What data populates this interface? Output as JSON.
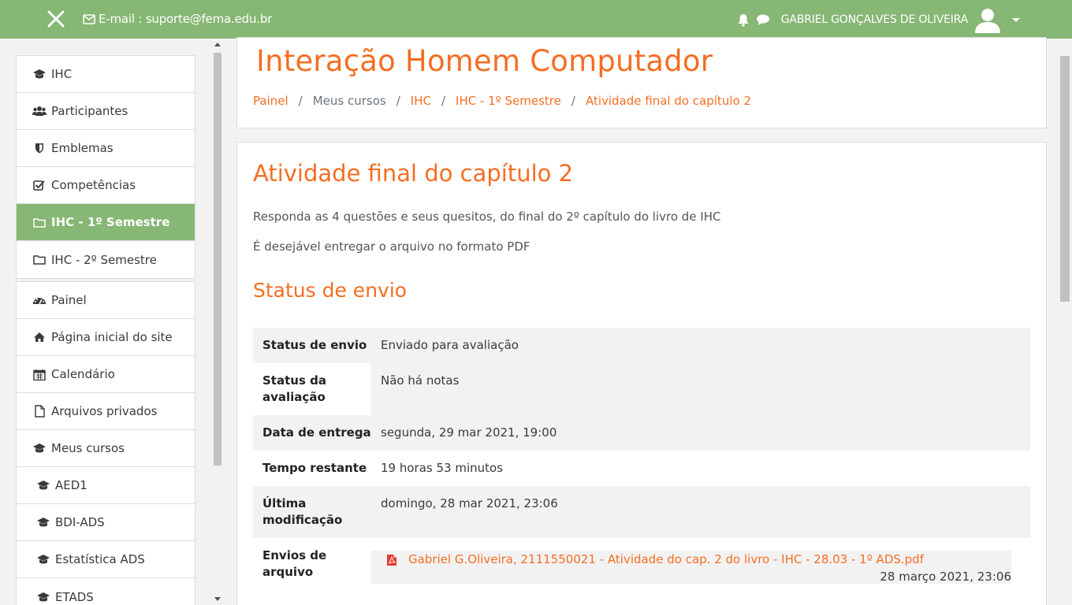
{
  "navbar": {
    "email_label": "E-mail : suporte@fema.edu.br",
    "username": "GABRIEL GONÇALVES DE OLIVEIRA"
  },
  "sidebar": {
    "course_items": [
      {
        "label": "IHC",
        "icon": "graduation-cap-icon"
      },
      {
        "label": "Participantes",
        "icon": "users-icon"
      },
      {
        "label": "Emblemas",
        "icon": "shield-icon"
      },
      {
        "label": "Competências",
        "icon": "checkbox-icon"
      },
      {
        "label": "IHC - 1º Semestre",
        "icon": "folder-icon",
        "active": true
      },
      {
        "label": "IHC - 2º Semestre",
        "icon": "folder-icon"
      }
    ],
    "site_items": [
      {
        "label": "Painel",
        "icon": "dashboard-icon"
      },
      {
        "label": "Página inicial do site",
        "icon": "home-icon"
      },
      {
        "label": "Calendário",
        "icon": "calendar-icon"
      },
      {
        "label": "Arquivos privados",
        "icon": "file-icon"
      },
      {
        "label": "Meus cursos",
        "icon": "graduation-cap-icon"
      },
      {
        "label": "AED1",
        "icon": "graduation-cap-icon"
      },
      {
        "label": "BDI-ADS",
        "icon": "graduation-cap-icon"
      },
      {
        "label": "Estatística ADS",
        "icon": "graduation-cap-icon"
      },
      {
        "label": "ETADS",
        "icon": "graduation-cap-icon"
      }
    ]
  },
  "header": {
    "title": "Interação Homem Computador",
    "breadcrumb": [
      "Painel",
      "Meus cursos",
      "IHC",
      "IHC - 1º Semestre",
      "Atividade final do capítulo 2"
    ]
  },
  "activity": {
    "title": "Atividade final do capítulo 2",
    "desc1": "Responda as 4 questões e seus quesitos, do final do 2º capítulo do livro de IHC",
    "desc2": "É desejável entregar o arquivo no formato PDF",
    "status_heading": "Status de envio",
    "rows": [
      {
        "key": "Status de envio",
        "value": "Enviado para avaliação"
      },
      {
        "key": "Status da avaliação",
        "value": "Não há notas"
      },
      {
        "key": "Data de entrega",
        "value": "segunda, 29 mar 2021, 19:00"
      },
      {
        "key": "Tempo restante",
        "value": "19 horas 53 minutos"
      },
      {
        "key": "Última modificação",
        "value": "domingo, 28 mar 2021, 23:06"
      },
      {
        "key": "Envios de arquivo",
        "value": ""
      }
    ],
    "file": {
      "name": "Gabriel G.Oliveira, 2111550021 - Atividade do cap. 2 do livro - IHC - 28.03 - 1º ADS.pdf",
      "date": "28 março 2021, 23:06"
    }
  },
  "colors": {
    "navbar": "#86b774",
    "accent": "#f46e22"
  }
}
